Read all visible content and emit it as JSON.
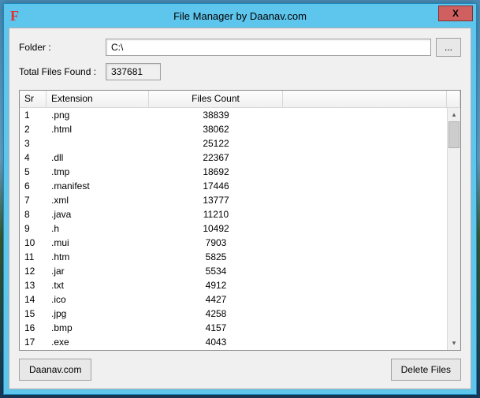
{
  "titlebar": {
    "icon_glyph": "F",
    "title": "File Manager by Daanav.com",
    "close_glyph": "X"
  },
  "form": {
    "folder_label": "Folder :",
    "folder_value": "C:\\",
    "browse_label": "...",
    "total_label": "Total Files Found :",
    "total_value": "337681"
  },
  "columns": {
    "sr": "Sr",
    "ext": "Extension",
    "count": "Files Count"
  },
  "rows": [
    {
      "sr": "1",
      "ext": ".png",
      "count": "38839"
    },
    {
      "sr": "2",
      "ext": ".html",
      "count": "38062"
    },
    {
      "sr": "3",
      "ext": "",
      "count": "25122"
    },
    {
      "sr": "4",
      "ext": ".dll",
      "count": "22367"
    },
    {
      "sr": "5",
      "ext": ".tmp",
      "count": "18692"
    },
    {
      "sr": "6",
      "ext": ".manifest",
      "count": "17446"
    },
    {
      "sr": "7",
      "ext": ".xml",
      "count": "13777"
    },
    {
      "sr": "8",
      "ext": ".java",
      "count": "11210"
    },
    {
      "sr": "9",
      "ext": ".h",
      "count": "10492"
    },
    {
      "sr": "10",
      "ext": ".mui",
      "count": "7903"
    },
    {
      "sr": "11",
      "ext": ".htm",
      "count": "5825"
    },
    {
      "sr": "12",
      "ext": ".jar",
      "count": "5534"
    },
    {
      "sr": "13",
      "ext": ".txt",
      "count": "4912"
    },
    {
      "sr": "14",
      "ext": ".ico",
      "count": "4427"
    },
    {
      "sr": "15",
      "ext": ".jpg",
      "count": "4258"
    },
    {
      "sr": "16",
      "ext": ".bmp",
      "count": "4157"
    },
    {
      "sr": "17",
      "ext": ".exe",
      "count": "4043"
    }
  ],
  "buttons": {
    "site": "Daanav.com",
    "delete": "Delete Files"
  }
}
